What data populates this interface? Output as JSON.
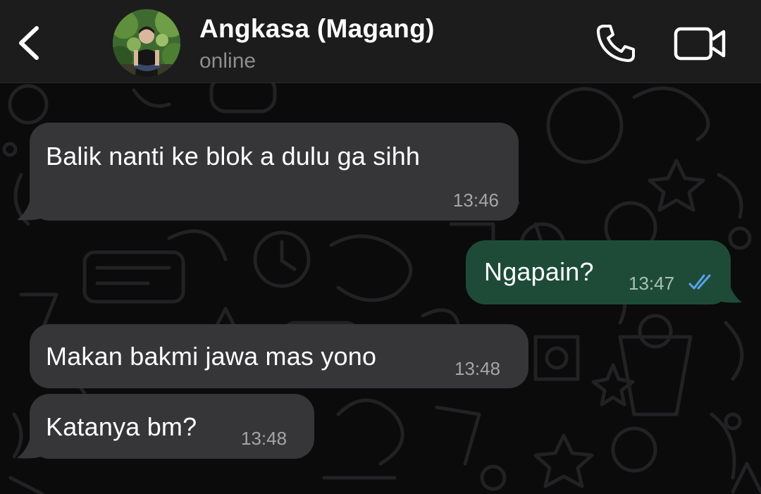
{
  "header": {
    "back_icon": "chevron-left-icon",
    "contact_name": "Angkasa (Magang)",
    "status": "online",
    "call_icon": "phone-icon",
    "video_icon": "video-camera-icon"
  },
  "messages": [
    {
      "direction": "incoming",
      "text": "Balik nanti ke blok a dulu ga sihh",
      "time": "13:46"
    },
    {
      "direction": "outgoing",
      "text": "Ngapain?",
      "time": "13:47",
      "status_icon": "double-check-read-icon"
    },
    {
      "direction": "incoming",
      "text": "Makan bakmi jawa mas yono",
      "time": "13:48"
    },
    {
      "direction": "incoming",
      "text": "Katanya bm?",
      "time": "13:48"
    }
  ],
  "colors": {
    "header_bg": "#1c1c1c",
    "chat_bg": "#0b0b0b",
    "incoming_bubble": "#363638",
    "outgoing_bubble": "#1e4b38",
    "read_tick": "#5aa3f0"
  }
}
